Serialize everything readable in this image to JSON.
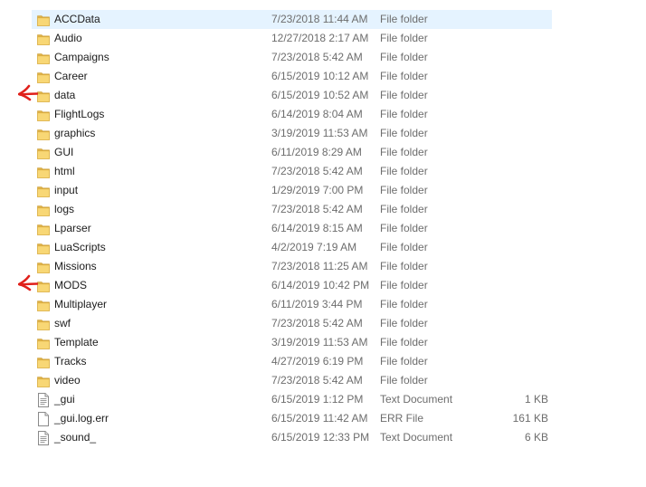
{
  "files": [
    {
      "name": "ACCData",
      "date": "7/23/2018 11:44 AM",
      "type": "File folder",
      "size": "",
      "icon": "folder-icon",
      "selected": true
    },
    {
      "name": "Audio",
      "date": "12/27/2018 2:17 AM",
      "type": "File folder",
      "size": "",
      "icon": "folder-icon"
    },
    {
      "name": "Campaigns",
      "date": "7/23/2018 5:42 AM",
      "type": "File folder",
      "size": "",
      "icon": "folder-icon"
    },
    {
      "name": "Career",
      "date": "6/15/2019 10:12 AM",
      "type": "File folder",
      "size": "",
      "icon": "folder-icon"
    },
    {
      "name": "data",
      "date": "6/15/2019 10:52 AM",
      "type": "File folder",
      "size": "",
      "icon": "folder-icon",
      "marked": true
    },
    {
      "name": "FlightLogs",
      "date": "6/14/2019 8:04 AM",
      "type": "File folder",
      "size": "",
      "icon": "folder-icon"
    },
    {
      "name": "graphics",
      "date": "3/19/2019 11:53 AM",
      "type": "File folder",
      "size": "",
      "icon": "folder-icon"
    },
    {
      "name": "GUI",
      "date": "6/11/2019 8:29 AM",
      "type": "File folder",
      "size": "",
      "icon": "folder-icon"
    },
    {
      "name": "html",
      "date": "7/23/2018 5:42 AM",
      "type": "File folder",
      "size": "",
      "icon": "folder-icon"
    },
    {
      "name": "input",
      "date": "1/29/2019 7:00 PM",
      "type": "File folder",
      "size": "",
      "icon": "folder-icon"
    },
    {
      "name": "logs",
      "date": "7/23/2018 5:42 AM",
      "type": "File folder",
      "size": "",
      "icon": "folder-icon"
    },
    {
      "name": "Lparser",
      "date": "6/14/2019 8:15 AM",
      "type": "File folder",
      "size": "",
      "icon": "folder-icon"
    },
    {
      "name": "LuaScripts",
      "date": "4/2/2019 7:19 AM",
      "type": "File folder",
      "size": "",
      "icon": "folder-icon"
    },
    {
      "name": "Missions",
      "date": "7/23/2018 11:25 AM",
      "type": "File folder",
      "size": "",
      "icon": "folder-icon"
    },
    {
      "name": "MODS",
      "date": "6/14/2019 10:42 PM",
      "type": "File folder",
      "size": "",
      "icon": "folder-icon",
      "marked": true
    },
    {
      "name": "Multiplayer",
      "date": "6/11/2019 3:44 PM",
      "type": "File folder",
      "size": "",
      "icon": "folder-icon"
    },
    {
      "name": "swf",
      "date": "7/23/2018 5:42 AM",
      "type": "File folder",
      "size": "",
      "icon": "folder-icon"
    },
    {
      "name": "Template",
      "date": "3/19/2019 11:53 AM",
      "type": "File folder",
      "size": "",
      "icon": "folder-icon"
    },
    {
      "name": "Tracks",
      "date": "4/27/2019 6:19 PM",
      "type": "File folder",
      "size": "",
      "icon": "folder-icon"
    },
    {
      "name": "video",
      "date": "7/23/2018 5:42 AM",
      "type": "File folder",
      "size": "",
      "icon": "folder-icon"
    },
    {
      "name": "_gui",
      "date": "6/15/2019 1:12 PM",
      "type": "Text Document",
      "size": "1 KB",
      "icon": "text-document-icon"
    },
    {
      "name": "_gui.log.err",
      "date": "6/15/2019 11:42 AM",
      "type": "ERR File",
      "size": "161 KB",
      "icon": "file-icon"
    },
    {
      "name": "_sound_",
      "date": "6/15/2019 12:33 PM",
      "type": "Text Document",
      "size": "6 KB",
      "icon": "text-document-icon"
    }
  ],
  "colors": {
    "selection": "#e5f3ff",
    "folder": "#f8d775",
    "folder_dark": "#e0b44c",
    "marker": "#e0201b",
    "secondary_text": "#6d6d6d"
  }
}
